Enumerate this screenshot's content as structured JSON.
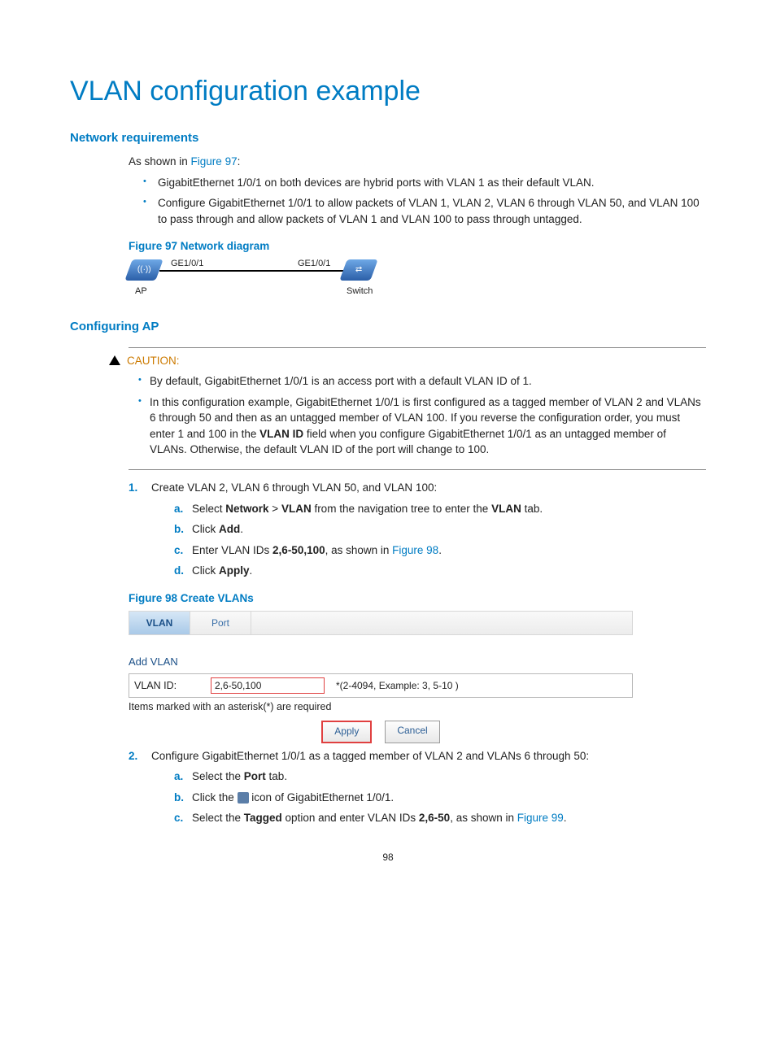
{
  "page_number": "98",
  "title": "VLAN configuration example",
  "section_network_req": {
    "heading": "Network requirements",
    "intro_prefix": "As shown in ",
    "intro_link": "Figure 97",
    "intro_suffix": ":",
    "bullets": [
      "GigabitEthernet 1/0/1 on both devices are hybrid ports with VLAN 1 as their default VLAN.",
      "Configure GigabitEthernet 1/0/1 to allow packets of VLAN 1, VLAN 2, VLAN 6 through VLAN 50, and VLAN 100 to pass through and allow packets of VLAN 1 and VLAN 100 to pass through untagged."
    ]
  },
  "figure97": {
    "caption": "Figure 97 Network diagram",
    "ap_label": "AP",
    "switch_label": "Switch",
    "ge_left": "GE1/0/1",
    "ge_right": "GE1/0/1"
  },
  "section_config_ap": {
    "heading": "Configuring AP"
  },
  "caution": {
    "label": "CAUTION:",
    "items": [
      {
        "text": "By default, GigabitEthernet 1/0/1 is an access port with a default VLAN ID of 1."
      },
      {
        "prefix": "In this configuration example, GigabitEthernet 1/0/1 is first configured as a tagged member of VLAN 2 and VLANs 6 through 50 and then as an untagged member of VLAN 100. If you reverse the configuration order, you must enter 1 and 100 in the ",
        "bold1": "VLAN ID",
        "suffix": " field when you configure GigabitEthernet 1/0/1 as an untagged member of VLANs. Otherwise, the default VLAN ID of the port will change to 100."
      }
    ]
  },
  "step1": {
    "text": "Create VLAN 2, VLAN 6 through VLAN 50, and VLAN 100:",
    "sub": {
      "a_pre": "Select ",
      "a_b1": "Network",
      "a_mid1": " > ",
      "a_b2": "VLAN",
      "a_mid2": " from the navigation tree to enter the ",
      "a_b3": "VLAN",
      "a_post": " tab.",
      "b_pre": "Click ",
      "b_b1": "Add",
      "b_post": ".",
      "c_pre": "Enter VLAN IDs ",
      "c_b1": "2,6-50,100",
      "c_mid": ", as shown in ",
      "c_link": "Figure 98",
      "c_post": ".",
      "d_pre": "Click ",
      "d_b1": "Apply",
      "d_post": "."
    }
  },
  "figure98": {
    "caption": "Figure 98 Create VLANs",
    "tab_vlan": "VLAN",
    "tab_port": "Port",
    "add_vlan_title": "Add VLAN",
    "vlan_id_label": "VLAN ID:",
    "vlan_id_value": "2,6-50,100",
    "vlan_id_hint": "*(2-4094, Example: 3, 5-10 )",
    "required_note": "Items marked with an asterisk(*) are required",
    "apply_btn": "Apply",
    "cancel_btn": "Cancel"
  },
  "step2": {
    "text": "Configure GigabitEthernet 1/0/1 as a tagged member of VLAN 2 and VLANs 6 through 50:",
    "sub": {
      "a_pre": "Select the ",
      "a_b1": "Port",
      "a_post": " tab.",
      "b_pre": "Click the ",
      "b_post": " icon of GigabitEthernet 1/0/1.",
      "c_pre": "Select the ",
      "c_b1": "Tagged",
      "c_mid": " option and enter VLAN IDs ",
      "c_b2": "2,6-50",
      "c_mid2": ", as shown in ",
      "c_link": "Figure 99",
      "c_post": "."
    }
  }
}
